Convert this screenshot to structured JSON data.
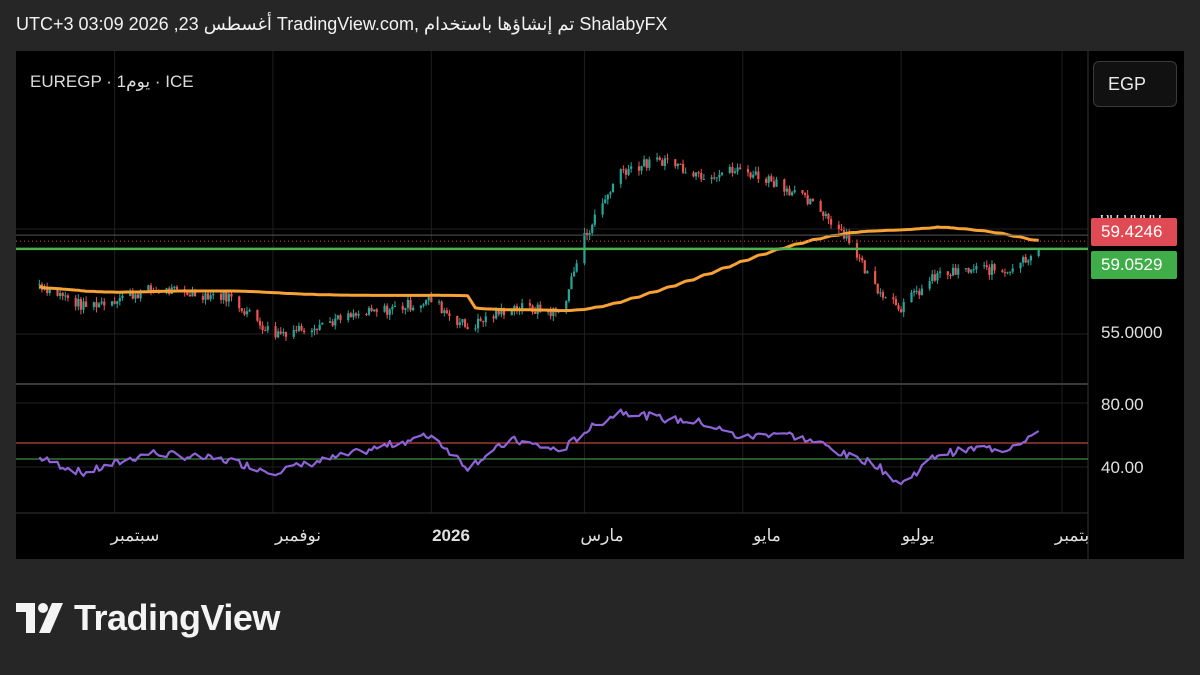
{
  "header": {
    "text": "UTC+3 أغسطس 23, 2026 03:09 TradingView.com, تم إنشاؤها باستخدام ShalabyFX"
  },
  "symbol": {
    "text": "EUREGP · 1يوم · ICE"
  },
  "currency_button": {
    "label": "EGP"
  },
  "price_tags": {
    "top_partial": "60.0000",
    "ma_value": "59.4246",
    "last_price": "59.0529",
    "level_55": "55.0000"
  },
  "rsi_axis": {
    "top": "80.00",
    "bottom": "40.00"
  },
  "x_labels": {
    "sep": "سبتمبر",
    "nov": "نوفمبر",
    "y2026": "2026",
    "mar": "مارس",
    "may": "مايو",
    "jul": "يوليو",
    "sep2": "بتمبر"
  },
  "brand": {
    "name": "TradingView"
  },
  "colors": {
    "up": "#26a69a",
    "down": "#ef5350",
    "ma": "#f7a234",
    "hline": "#4caf50",
    "rsi": "#8e63d8",
    "rsi_upper": "#ef5350",
    "rsi_lower": "#4caf50",
    "tag_red": "#e04a54",
    "tag_green": "#3fae49"
  },
  "chart_data": {
    "type": "candlestick",
    "price_axis": {
      "ticks": [
        55,
        60
      ],
      "visible_range": [
        53,
        64
      ]
    },
    "horizontal_line": 59.0529,
    "ma_last": 59.4246,
    "rsi": {
      "upper": 55,
      "lower": 45,
      "ticks": [
        40,
        80
      ]
    },
    "x_ticks": [
      "سبتمبر",
      "نوفمبر",
      "2026",
      "مارس",
      "مايو",
      "يوليو",
      "بتمبر"
    ],
    "series": [
      {
        "name": "close_keypoints",
        "x": [
          "2025-08-01",
          "2025-08-20",
          "2025-09-15",
          "2025-10-15",
          "2025-11-01",
          "2025-12-01",
          "2026-01-01",
          "2026-01-15",
          "2026-02-01",
          "2026-02-20",
          "2026-03-01",
          "2026-03-15",
          "2026-04-01",
          "2026-04-15",
          "2026-05-01",
          "2026-05-15",
          "2026-06-01",
          "2026-06-10",
          "2026-06-20",
          "2026-07-01",
          "2026-07-15",
          "2026-08-01",
          "2026-08-10",
          "2026-08-23"
        ],
        "values": [
          57.5,
          56.3,
          57.1,
          56.8,
          55.0,
          55.8,
          56.6,
          55.3,
          56.3,
          56.0,
          59.6,
          62.8,
          63.3,
          62.6,
          62.8,
          62.2,
          60.8,
          59.7,
          57.4,
          56.3,
          57.8,
          58.1,
          58.0,
          59.05
        ]
      },
      {
        "name": "rsi_keypoints",
        "x": [
          "2025-08-01",
          "2025-08-20",
          "2025-09-15",
          "2025-10-15",
          "2025-11-01",
          "2025-12-01",
          "2026-01-01",
          "2026-01-15",
          "2026-02-01",
          "2026-02-20",
          "2026-03-01",
          "2026-03-15",
          "2026-04-01",
          "2026-04-15",
          "2026-05-01",
          "2026-05-15",
          "2026-06-01",
          "2026-06-10",
          "2026-06-20",
          "2026-07-01",
          "2026-07-15",
          "2026-08-01",
          "2026-08-10",
          "2026-08-23"
        ],
        "values": [
          47,
          36,
          49,
          44,
          37,
          48,
          60,
          40,
          57,
          50,
          62,
          75,
          70,
          68,
          58,
          62,
          54,
          47,
          43,
          29,
          48,
          52,
          51,
          62
        ]
      }
    ]
  }
}
